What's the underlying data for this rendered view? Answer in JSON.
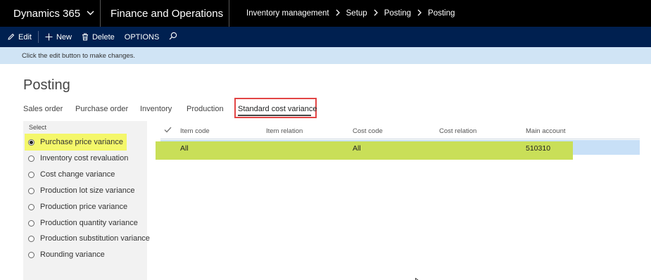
{
  "header": {
    "brand": "Dynamics 365",
    "app": "Finance and Operations",
    "breadcrumb": [
      "Inventory management",
      "Setup",
      "Posting",
      "Posting"
    ]
  },
  "actions": {
    "edit": "Edit",
    "new": "New",
    "delete": "Delete",
    "options": "OPTIONS"
  },
  "info_message": "Click the edit button to make changes.",
  "page_title": "Posting",
  "tabs": [
    "Sales order",
    "Purchase order",
    "Inventory",
    "Production",
    "Standard cost variance"
  ],
  "active_tab": "Standard cost variance",
  "select": {
    "label": "Select",
    "options": [
      "Purchase price variance",
      "Inventory cost revaluation",
      "Cost change variance",
      "Production lot size variance",
      "Production price variance",
      "Production quantity variance",
      "Production substitution variance",
      "Rounding variance"
    ],
    "selected": "Purchase price variance"
  },
  "grid": {
    "columns": [
      "Item code",
      "Item relation",
      "Cost code",
      "Cost relation",
      "Main account"
    ],
    "rows": [
      {
        "item_code": "All",
        "item_relation": "",
        "cost_code": "All",
        "cost_relation": "",
        "main_account": "510310"
      }
    ]
  },
  "colors": {
    "topbar": "#000000",
    "actionbar": "#002050",
    "infobar": "#d0e4f5",
    "highlight_yellow": "#f4f76a",
    "highlight_green": "#c9df58",
    "highlight_red": "#e24545",
    "selected_row": "#c8e0f7"
  }
}
